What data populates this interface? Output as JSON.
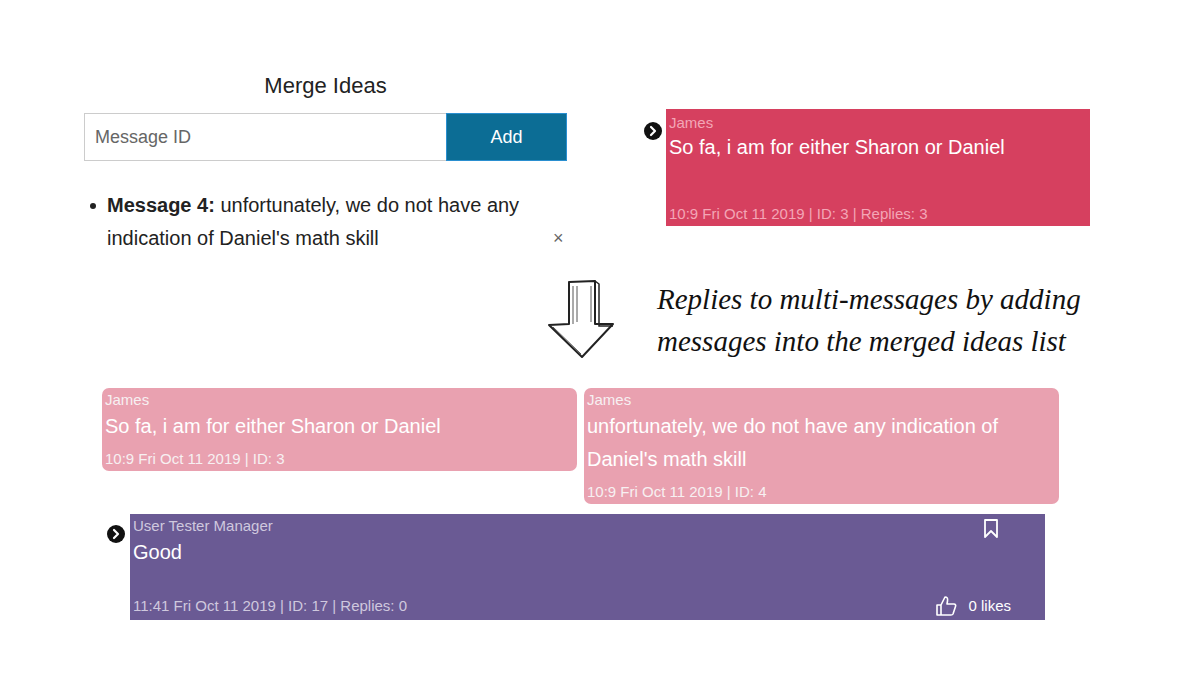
{
  "merge_panel": {
    "title": "Merge Ideas",
    "input": {
      "placeholder": "Message ID"
    },
    "add_button": "Add",
    "items": [
      {
        "label": "Message 4:",
        "text": "unfortunately, we do not have any indication of Daniel's math skill",
        "remove": "×"
      }
    ]
  },
  "source_message": {
    "author": "James",
    "text": "So fa, i am for either Sharon or Daniel",
    "meta": "10:9 Fri Oct 11 2019 | ID: 3 | Replies: 3"
  },
  "annotation": {
    "lines": [
      "Replies to multi-messages by adding",
      "messages into the merged ideas list"
    ]
  },
  "merged_messages": [
    {
      "author": "James",
      "text": "So fa, i am for either Sharon or Daniel",
      "meta": "10:9 Fri Oct 11 2019 | ID: 3"
    },
    {
      "author": "James",
      "text": "unfortunately, we do not have any indication of Daniel's math skill",
      "meta": "10:9 Fri Oct 11 2019 | ID: 4"
    }
  ],
  "reply": {
    "author": "User Tester Manager",
    "text": "Good",
    "meta": "11:41 Fri Oct 11 2019 | ID: 17 | Replies: 0",
    "likes": "0 likes",
    "bookmarked": false,
    "liked": false
  }
}
